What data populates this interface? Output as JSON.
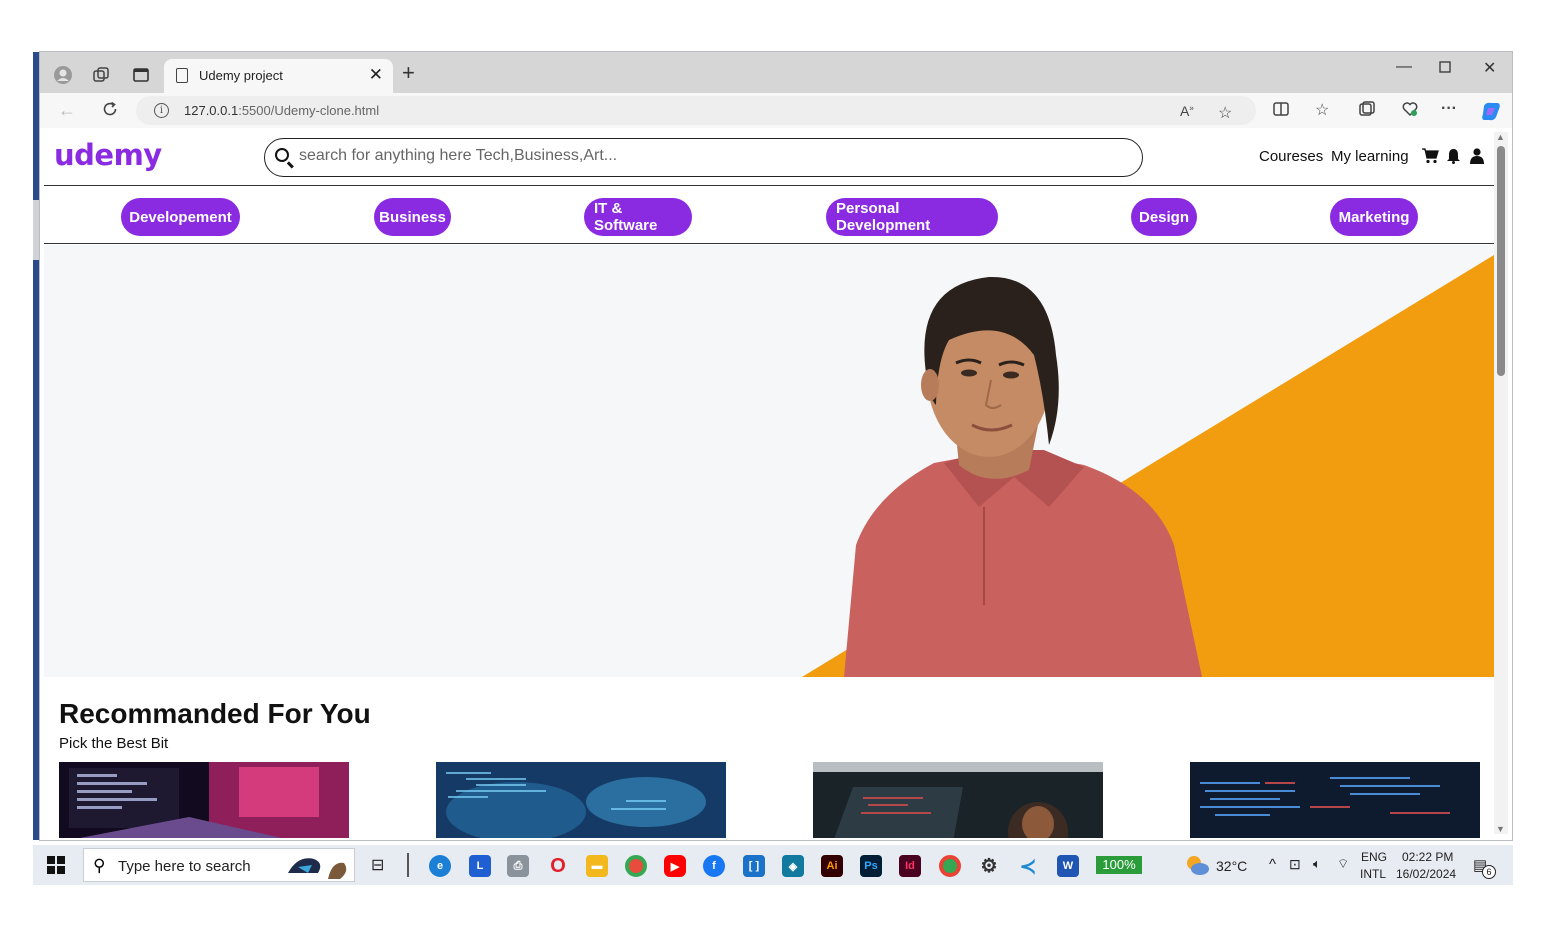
{
  "browser": {
    "tab_title": "Udemy project",
    "url_host": "127.0.0.1",
    "url_path": ":5500/Udemy-clone.html"
  },
  "site": {
    "logo": "udemy",
    "search_placeholder": "search for anything here Tech,Business,Art...",
    "nav": {
      "courses": "Coureses",
      "my_learning": "My learning"
    },
    "categories": [
      "Developement",
      "Business",
      "IT & Software",
      "Personal Development",
      "Design",
      "Marketing"
    ],
    "accent_color": "#8a2be2",
    "hero_accent_color": "#f29d0f"
  },
  "recommended": {
    "title": "Recommanded For You",
    "subtitle": "Pick the Best Bit"
  },
  "taskbar": {
    "search_placeholder": "Type here to search",
    "battery": "100%",
    "temperature": "32°C",
    "lang_line1": "ENG",
    "lang_line2": "INTL",
    "time": "02:22 PM",
    "date": "16/02/2024",
    "notification_count": "6",
    "app_letters": {
      "l": "L",
      "ai": "Ai",
      "ps": "Ps",
      "id": "Id"
    }
  }
}
